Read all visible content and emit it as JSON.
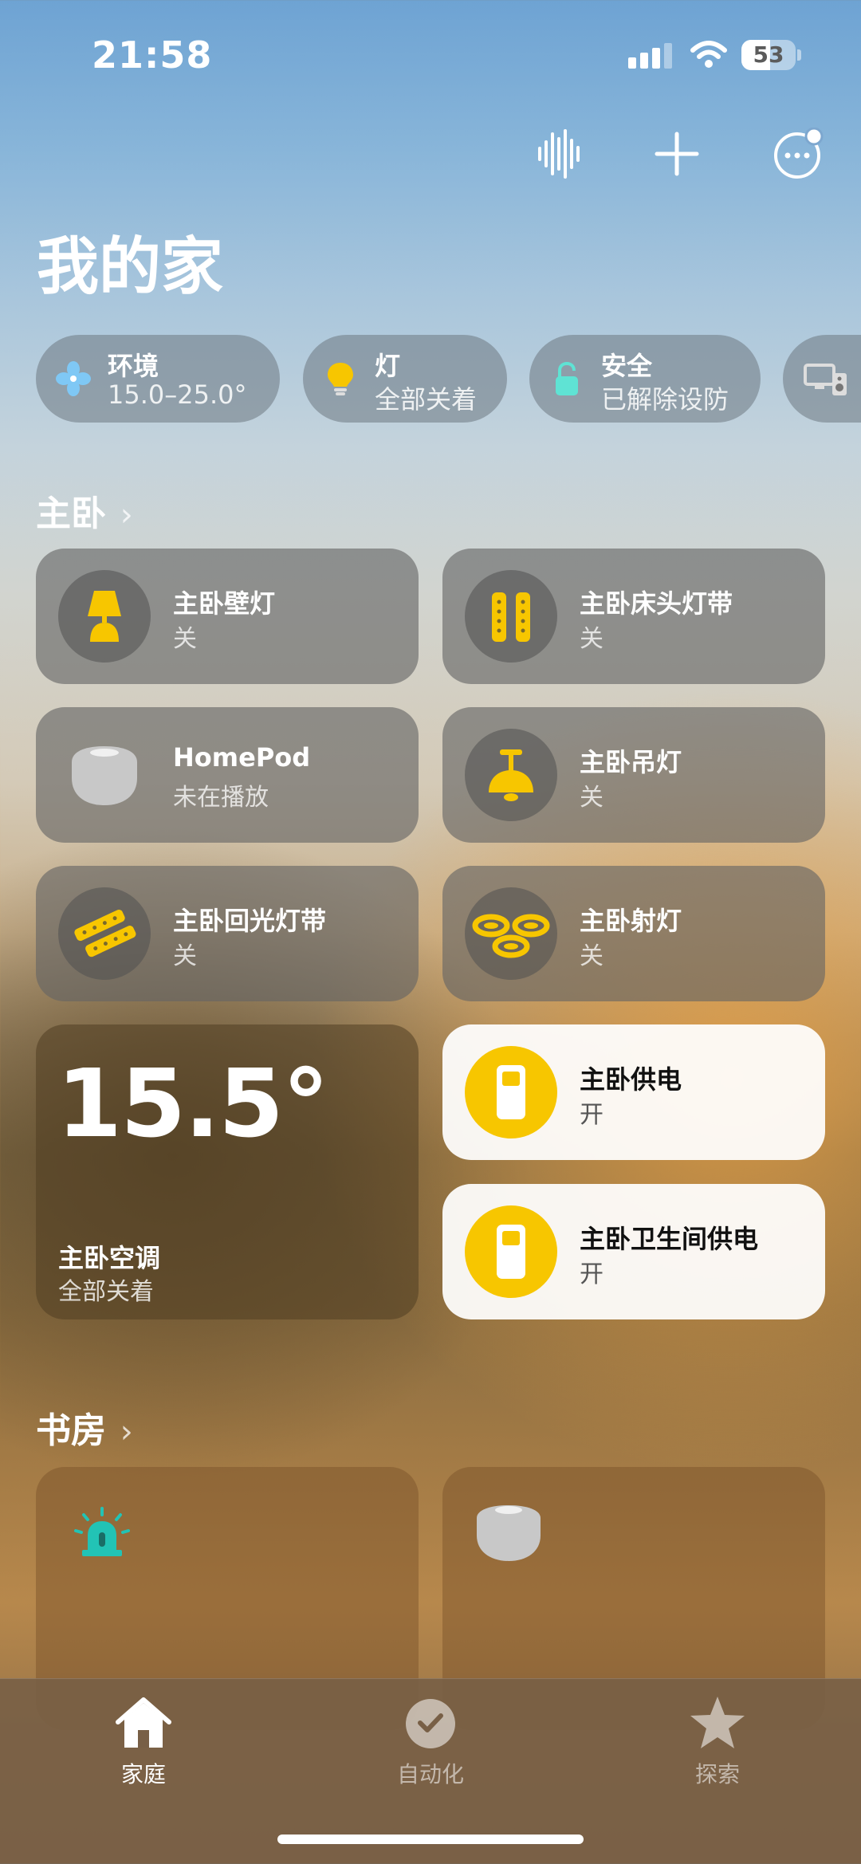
{
  "status_bar": {
    "time": "21:58",
    "battery": "53",
    "battery_level_percent": 53
  },
  "header": {
    "title": "我的家",
    "icons": [
      "siri-waveform-icon",
      "add-icon",
      "more-options-icon"
    ]
  },
  "summary_pills": [
    {
      "icon": "fan-icon",
      "title": "环境",
      "subtitle": "15.0–25.0°"
    },
    {
      "icon": "lightbulb-icon",
      "title": "灯",
      "subtitle": "全部关着"
    },
    {
      "icon": "lock-icon",
      "title": "安全",
      "subtitle": "已解除设防"
    },
    {
      "icon": "media-devices-icon"
    }
  ],
  "rooms": [
    {
      "name": "主卧",
      "accessories": [
        {
          "name": "主卧壁灯",
          "state": "关",
          "icon": "table-lamp-icon",
          "on": false
        },
        {
          "name": "主卧床头灯带",
          "state": "关",
          "icon": "light-strip-icon",
          "on": false
        },
        {
          "name": "HomePod",
          "state": "未在播放",
          "icon": "homepod-icon",
          "on": false
        },
        {
          "name": "主卧吊灯",
          "state": "关",
          "icon": "ceiling-light-icon",
          "on": false
        },
        {
          "name": "主卧回光灯带",
          "state": "关",
          "icon": "light-strip-diagonal-icon",
          "on": false
        },
        {
          "name": "主卧射灯",
          "state": "关",
          "icon": "spotlight-icon",
          "on": false
        }
      ],
      "climate": {
        "temperature": "15.5°",
        "name": "主卧空调",
        "state": "全部关着"
      },
      "outlets": [
        {
          "name": "主卧供电",
          "state": "开",
          "icon": "switch-icon",
          "on": true
        },
        {
          "name": "主卧卫生间供电",
          "state": "开",
          "icon": "switch-icon",
          "on": true
        }
      ]
    },
    {
      "name": "书房",
      "tiles": [
        {
          "icon": "siren-icon"
        },
        {
          "icon": "homepod-icon"
        }
      ]
    }
  ],
  "tab_bar": [
    {
      "label": "家庭",
      "icon": "home-icon",
      "active": true
    },
    {
      "label": "自动化",
      "icon": "automation-clock-icon",
      "active": false
    },
    {
      "label": "探索",
      "icon": "star-icon",
      "active": false
    }
  ],
  "colors": {
    "accent_yellow": "#F7C600",
    "teal": "#22C3B5",
    "fan_blue": "#7FC8F5"
  }
}
